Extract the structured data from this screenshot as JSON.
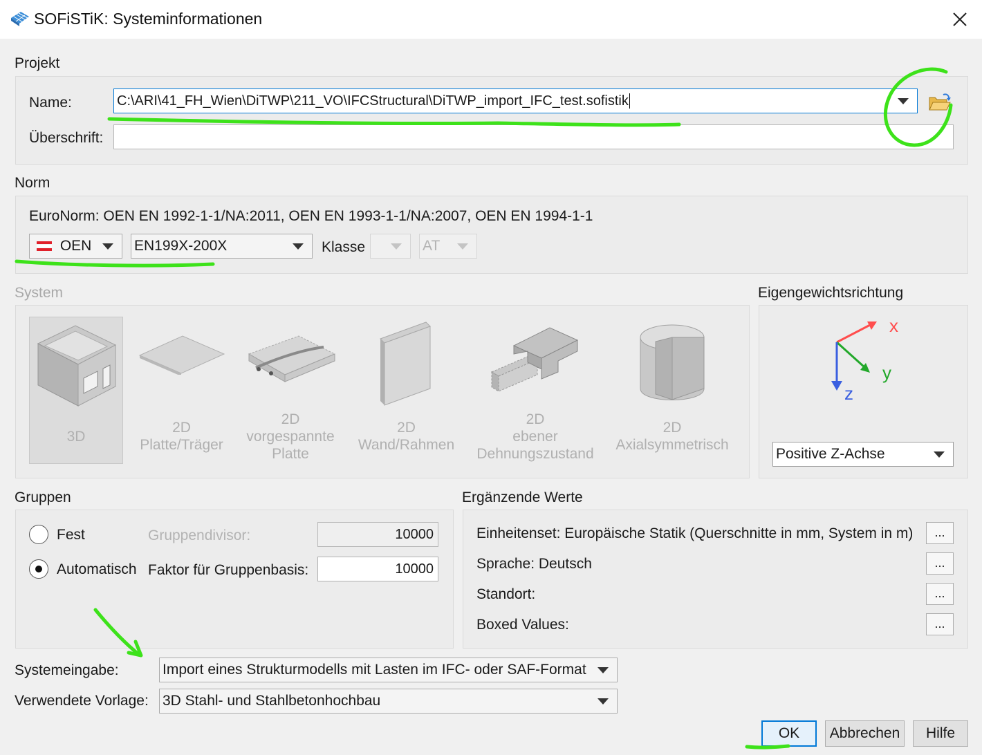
{
  "window": {
    "title": "SOFiSTiK: Systeminformationen",
    "close_glyph": "✕"
  },
  "projekt": {
    "section": "Projekt",
    "name_label": "Name:",
    "name_value": "C:\\ARI\\41_FH_Wien\\DiTWP\\211_VO\\IFCStructural\\DiTWP_import_IFC_test.sofistik",
    "ueberschrift_label": "Überschrift:",
    "ueberschrift_value": ""
  },
  "norm": {
    "section": "Norm",
    "euronorm_text": "EuroNorm: OEN EN 1992-1-1/NA:2011, OEN EN 1993-1-1/NA:2007, OEN EN 1994-1-1",
    "country": "OEN",
    "standard": "EN199X-200X",
    "klasse_label": "Klasse",
    "klasse_value": "",
    "region_value": "AT"
  },
  "system": {
    "section": "System",
    "items": [
      {
        "line1": "3D",
        "line2": "",
        "line3": ""
      },
      {
        "line1": "2D",
        "line2": "Platte/Träger",
        "line3": ""
      },
      {
        "line1": "2D",
        "line2": "vorgespannte",
        "line3": "Platte"
      },
      {
        "line1": "2D",
        "line2": "Wand/Rahmen",
        "line3": ""
      },
      {
        "line1": "2D",
        "line2": "ebener",
        "line3": "Dehnungszustand"
      },
      {
        "line1": "2D",
        "line2": "Axialsymmetrisch",
        "line3": ""
      }
    ]
  },
  "eigengewicht": {
    "section": "Eigengewichtsrichtung",
    "axis_x": "x",
    "axis_y": "y",
    "axis_z": "z",
    "direction": "Positive Z-Achse",
    "colors": {
      "x": "#ff4d4d",
      "y": "#22a82a",
      "z": "#3a5fe0"
    }
  },
  "gruppen": {
    "section": "Gruppen",
    "fest_label": "Fest",
    "auto_label": "Automatisch",
    "selected": "Automatisch",
    "divisor_label": "Gruppendivisor:",
    "divisor_value": "10000",
    "faktor_label": "Faktor für Gruppenbasis:",
    "faktor_value": "10000"
  },
  "ergaenzende": {
    "section": "Ergänzende Werte",
    "rows": [
      {
        "label": "Einheitenset: Europäische Statik (Querschnitte in mm, System in m)",
        "button": "..."
      },
      {
        "label": "Sprache: Deutsch",
        "button": "..."
      },
      {
        "label": "Standort:",
        "button": "..."
      },
      {
        "label": "Boxed Values:",
        "button": "..."
      }
    ]
  },
  "systemeingabe": {
    "label": "Systemeingabe:",
    "value": "Import eines Strukturmodells mit Lasten im IFC- oder SAF-Format"
  },
  "vorlage": {
    "label": "Verwendete Vorlage:",
    "value": "3D Stahl- und Stahlbetonhochbau"
  },
  "buttons": {
    "ok": "OK",
    "cancel": "Abbrechen",
    "help": "Hilfe"
  },
  "annotation_color": "#3de21a"
}
